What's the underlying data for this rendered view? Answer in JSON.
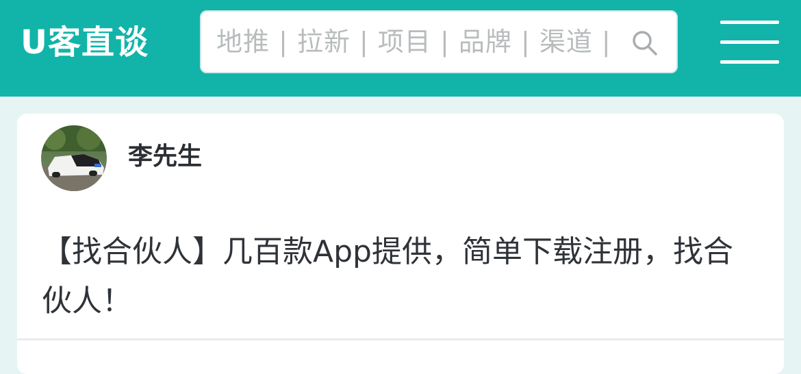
{
  "header": {
    "logo": "U客直谈",
    "search_placeholder": "地推 | 拉新 | 项目 | 品牌 | 渠道 |",
    "search_icon": "search-icon",
    "menu_icon": "hamburger-menu-icon",
    "background_color": "#12b4a9"
  },
  "post": {
    "author": "李先生",
    "content": "【找合伙人】几百款App提供，简单下载注册，找合伙人！"
  }
}
